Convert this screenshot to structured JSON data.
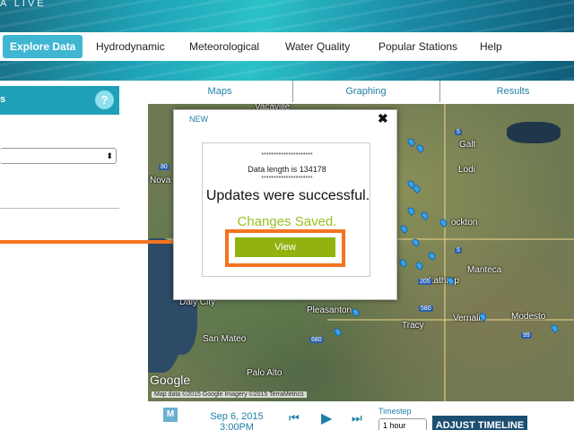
{
  "header": {
    "brand": "A LIVE"
  },
  "nav": {
    "items": [
      {
        "label": "Explore Data"
      },
      {
        "label": "Hydrodynamic"
      },
      {
        "label": "Meteorological"
      },
      {
        "label": "Water Quality"
      },
      {
        "label": "Popular Stations"
      },
      {
        "label": "Help"
      }
    ]
  },
  "sidebar": {
    "title": "s",
    "help": "?",
    "select_value": "",
    "select_arrow": "⬍"
  },
  "tabs": [
    {
      "label": "Maps"
    },
    {
      "label": "Graphing"
    },
    {
      "label": "Results"
    }
  ],
  "map": {
    "labels": {
      "vacaville": "Vacaville",
      "lodi": "Lodi",
      "stockton": "ockton",
      "manteca": "Manteca",
      "pleasanton": "Pleasanton",
      "san_mateo": "San Mateo",
      "palo_alto": "Palo Alto",
      "modesto": "Modesto",
      "daly_city": "Daly City",
      "novato": "Nova",
      "galt": "Galt",
      "tracy": "Tracy",
      "vernalis": "Vernalis",
      "lathrop": "Lathrop"
    },
    "shields": {
      "s5": "5",
      "s580": "580",
      "s680": "680",
      "s205": "205",
      "s99": "99",
      "s80": "80"
    },
    "google": "Google",
    "attribution": "Map data ©2015 Google Imagery ©2015 TerraMetrics"
  },
  "modal": {
    "title": "NEW",
    "close": "✖",
    "stars": "*********************",
    "length_text": "Data length is 134178",
    "success_text": "Updates were successful.",
    "saved_text": "Changes Saved.",
    "view_label": "View"
  },
  "bottom": {
    "m_label": "M",
    "date": "Sep 6, 2015",
    "time": "3:00PM",
    "prev": "⏮",
    "play": "▶",
    "next": "⏭",
    "timestep_label": "Timestep",
    "timestep_value": "1 hour",
    "adjust_label": "ADJUST TIMELINE"
  },
  "colors": {
    "accent": "#1ea0b8",
    "highlight": "#f47320",
    "button_green": "#92b30f",
    "saved_green": "#9bbf23",
    "link_blue": "#1e7fa6"
  }
}
